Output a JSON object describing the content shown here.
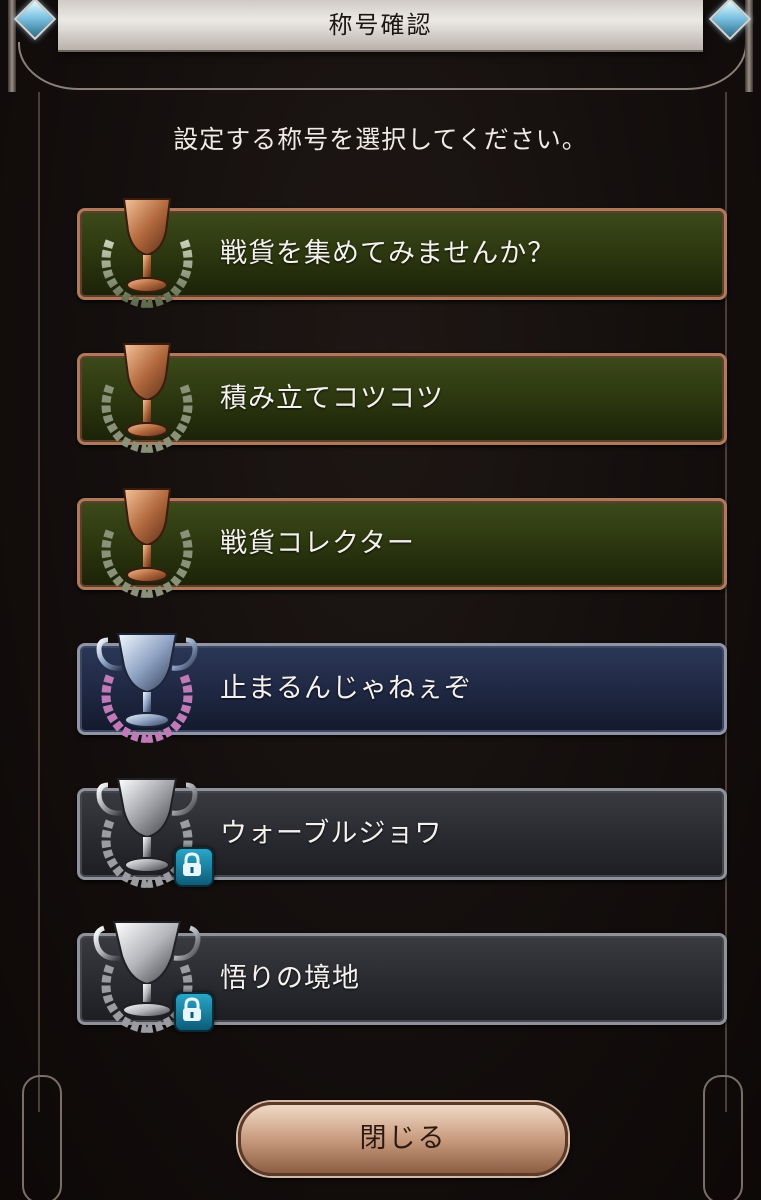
{
  "dialog": {
    "title": "称号確認",
    "prompt": "設定する称号を選択してください。",
    "close_label": "閉じる"
  },
  "titles": [
    {
      "label": "戦貨を集めてみませんか？",
      "tier": "bronze",
      "locked": false
    },
    {
      "label": "積み立てコツコツ",
      "tier": "bronze",
      "locked": false
    },
    {
      "label": "戦貨コレクター",
      "tier": "bronze",
      "locked": false
    },
    {
      "label": "止まるんじゃねぇぞ",
      "tier": "silver",
      "locked": false
    },
    {
      "label": "ウォーブルジョワ",
      "tier": "silver",
      "locked": true
    },
    {
      "label": "悟りの境地",
      "tier": "silver",
      "locked": true
    }
  ],
  "colors": {
    "bronze_plate": "#2e3910",
    "silver_active_plate": "#212a46",
    "locked_plate": "#2c2d33",
    "lock_badge": "#1b86a8",
    "gem": "#7fc5e3"
  }
}
